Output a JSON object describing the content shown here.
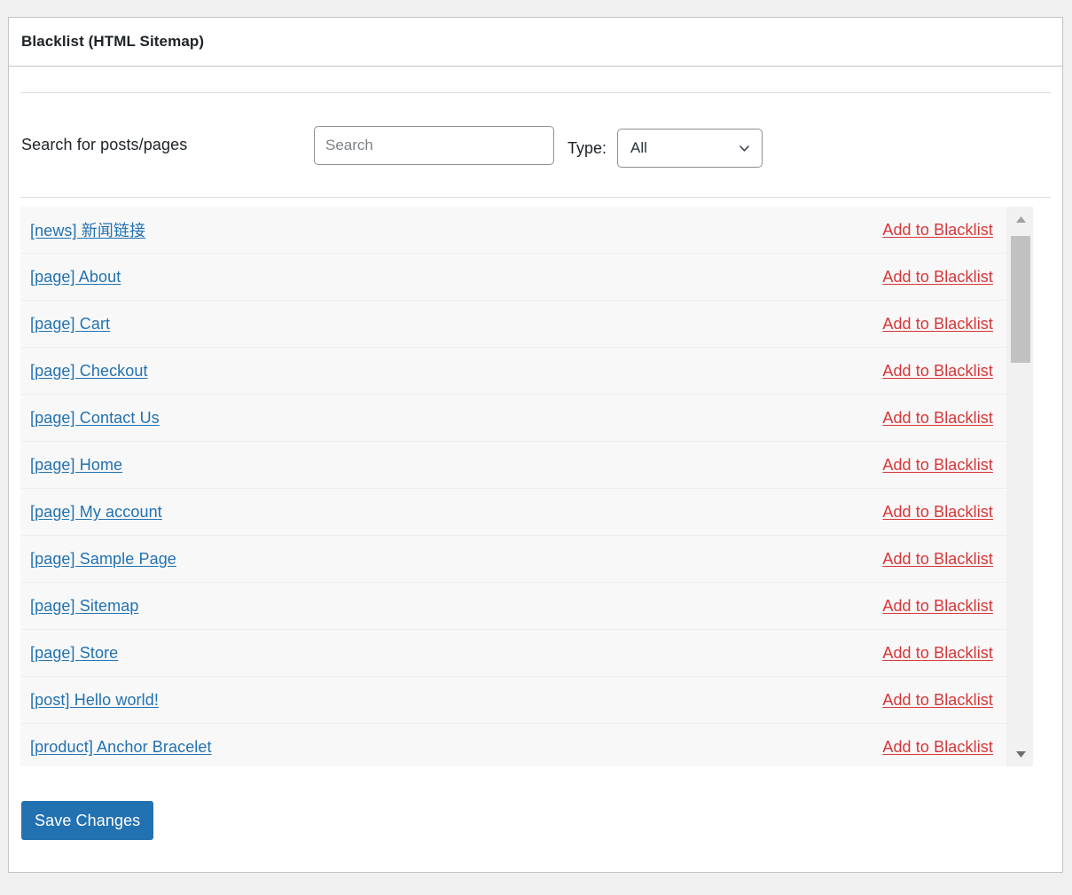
{
  "panel": {
    "title": "Blacklist (HTML Sitemap)"
  },
  "search": {
    "label": "Search for posts/pages",
    "placeholder": "Search",
    "value": "",
    "type_label": "Type:",
    "type_selected": "All",
    "type_options": [
      "All"
    ]
  },
  "list": {
    "action_label": "Add to Blacklist",
    "items": [
      {
        "label": "[news] 新闻链接"
      },
      {
        "label": "[page] About"
      },
      {
        "label": "[page] Cart"
      },
      {
        "label": "[page] Checkout"
      },
      {
        "label": "[page] Contact Us"
      },
      {
        "label": "[page] Home"
      },
      {
        "label": "[page] My account"
      },
      {
        "label": "[page] Sample Page"
      },
      {
        "label": "[page] Sitemap"
      },
      {
        "label": "[page] Store"
      },
      {
        "label": "[post] Hello world!"
      },
      {
        "label": "[product] Anchor Bracelet"
      }
    ]
  },
  "footer": {
    "save_label": "Save Changes"
  },
  "colors": {
    "accent": "#2271b1",
    "link": "#2271b1",
    "danger": "#d63638",
    "page_bg": "#f0f0f1",
    "panel_bg": "#ffffff",
    "border": "#c3c4c7",
    "row_bg": "#f8f8f8",
    "scrollbar_thumb": "#c1c1c1",
    "scrollbar_track": "#f1f1f1"
  }
}
